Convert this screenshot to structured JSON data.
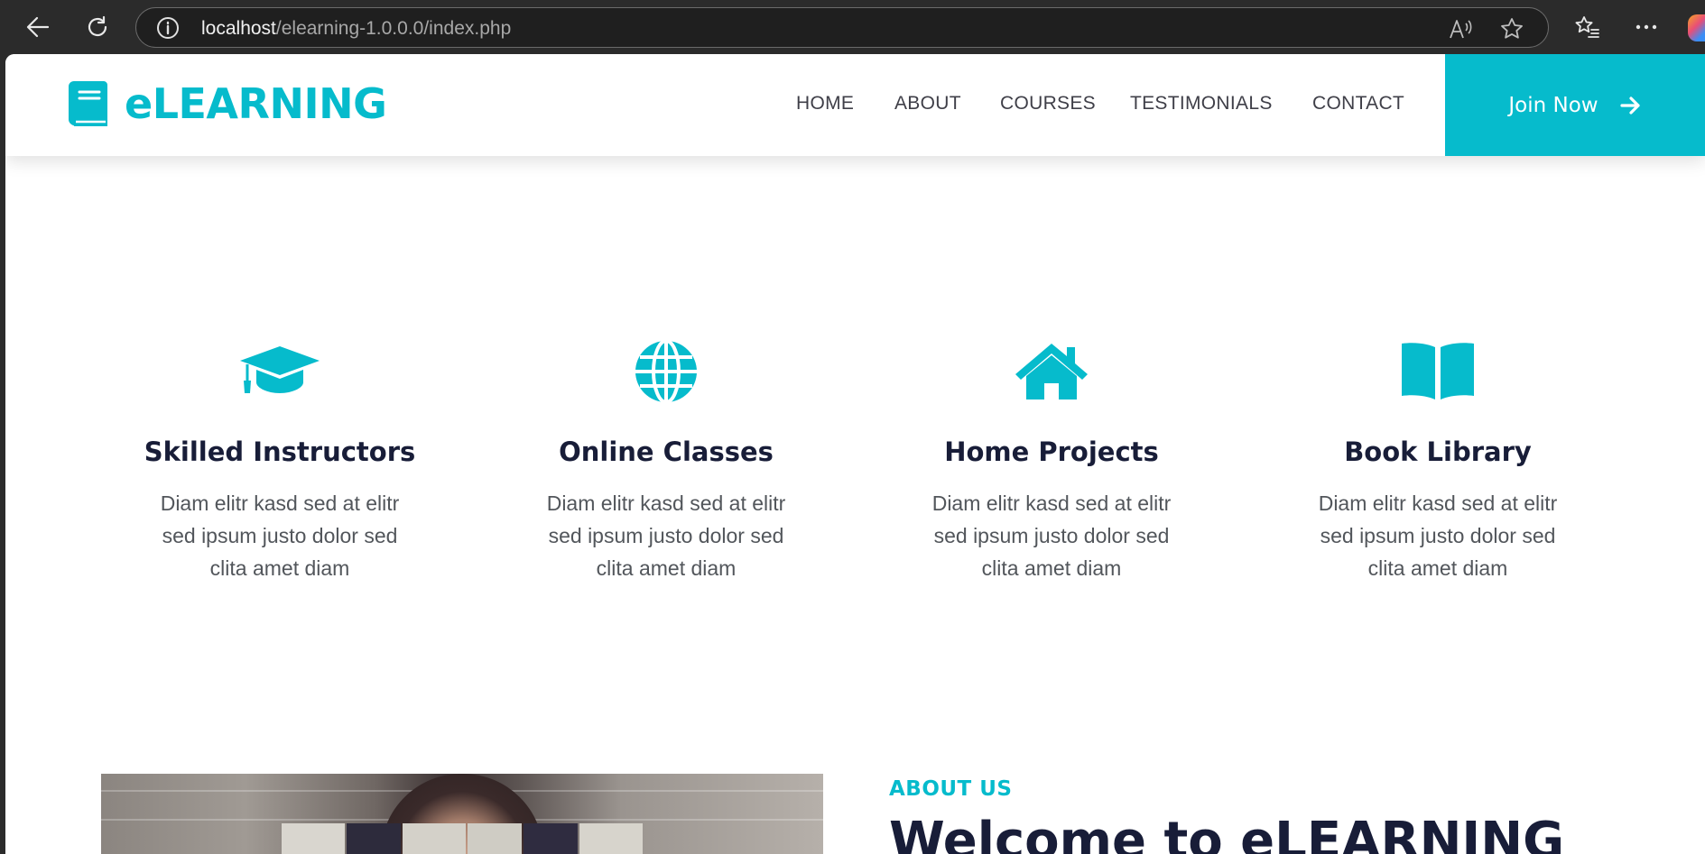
{
  "browser": {
    "url_host": "localhost",
    "url_path": "/elearning-1.0.0.0/index.php"
  },
  "brand": {
    "name": "eLEARNING"
  },
  "nav": {
    "items": [
      "HOME",
      "ABOUT",
      "COURSES",
      "TESTIMONIALS",
      "CONTACT"
    ],
    "join_label": "Join Now"
  },
  "features": [
    {
      "icon": "graduation-cap-icon",
      "title": "Skilled Instructors",
      "text": "Diam elitr kasd sed at elitr sed ipsum justo dolor sed clita amet diam"
    },
    {
      "icon": "globe-icon",
      "title": "Online Classes",
      "text": "Diam elitr kasd sed at elitr sed ipsum justo dolor sed clita amet diam"
    },
    {
      "icon": "home-icon",
      "title": "Home Projects",
      "text": "Diam elitr kasd sed at elitr sed ipsum justo dolor sed clita amet diam"
    },
    {
      "icon": "book-open-icon",
      "title": "Book Library",
      "text": "Diam elitr kasd sed at elitr sed ipsum justo dolor sed clita amet diam"
    }
  ],
  "about": {
    "subtitle": "ABOUT US",
    "title": "Welcome to eLEARNING"
  },
  "colors": {
    "accent": "#06bbcc",
    "heading": "#181d38",
    "body_text": "#52565b"
  }
}
